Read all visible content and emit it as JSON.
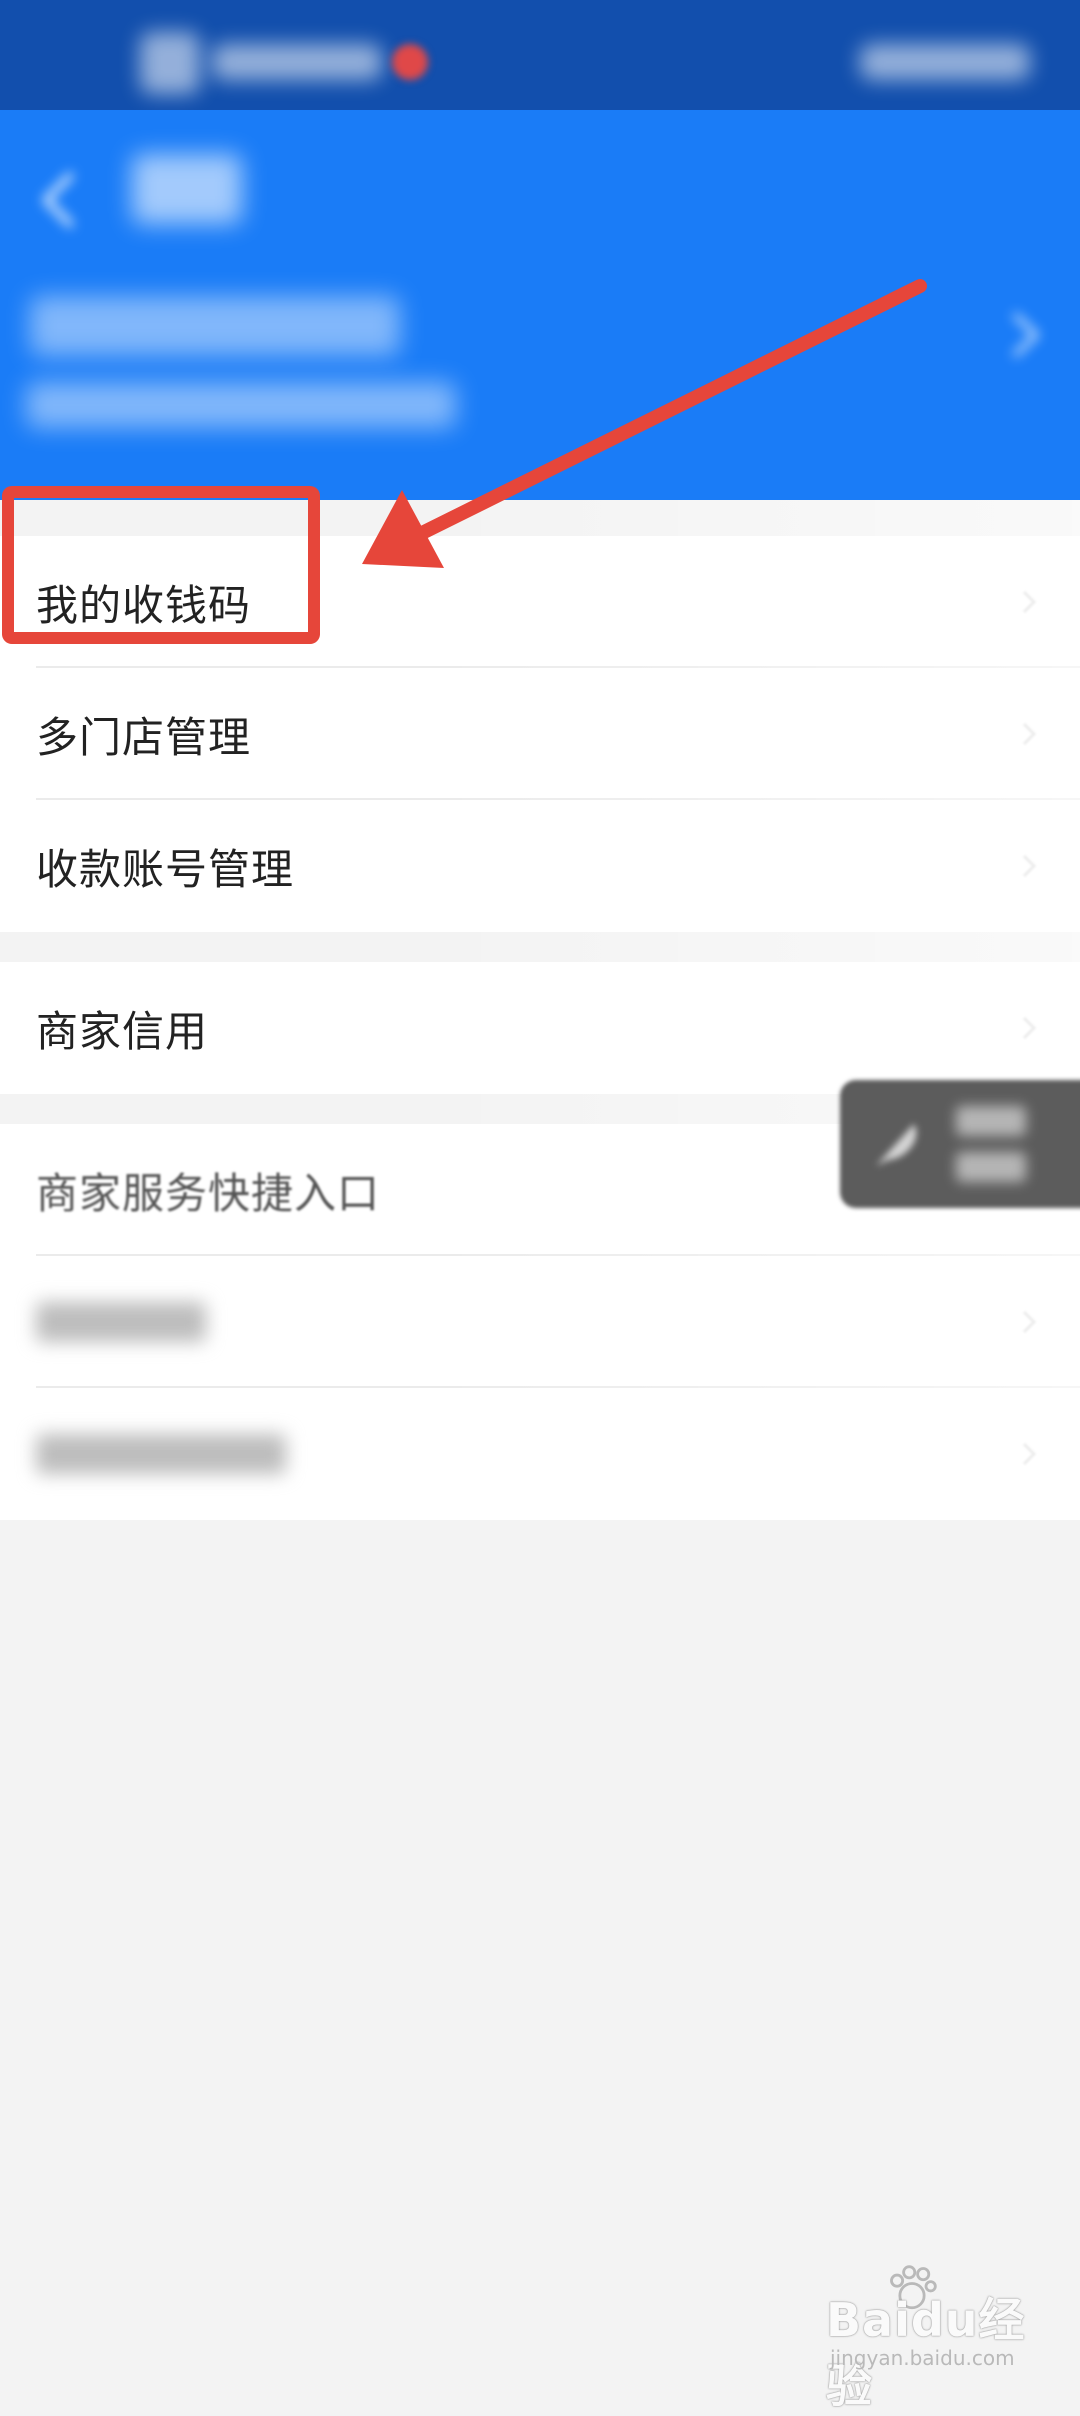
{
  "list_primary": {
    "items": [
      {
        "label": "我的收钱码"
      },
      {
        "label": "多门店管理"
      },
      {
        "label": "收款账号管理"
      }
    ]
  },
  "list_credit": {
    "items": [
      {
        "label": "商家信用"
      }
    ]
  },
  "list_services": {
    "title": "商家服务快捷入口"
  },
  "colors": {
    "header_blue": "#1a7cf7",
    "status_bar_blue": "#124fad",
    "annotation_red": "#e6463a",
    "background_gray": "#f3f3f3"
  },
  "icons": {
    "back": "back-arrow-icon",
    "chevron": "chevron-right-icon",
    "float": "feather-icon"
  },
  "watermark": {
    "brand": "Baidu经验",
    "url": "jingyan.baidu.com"
  }
}
